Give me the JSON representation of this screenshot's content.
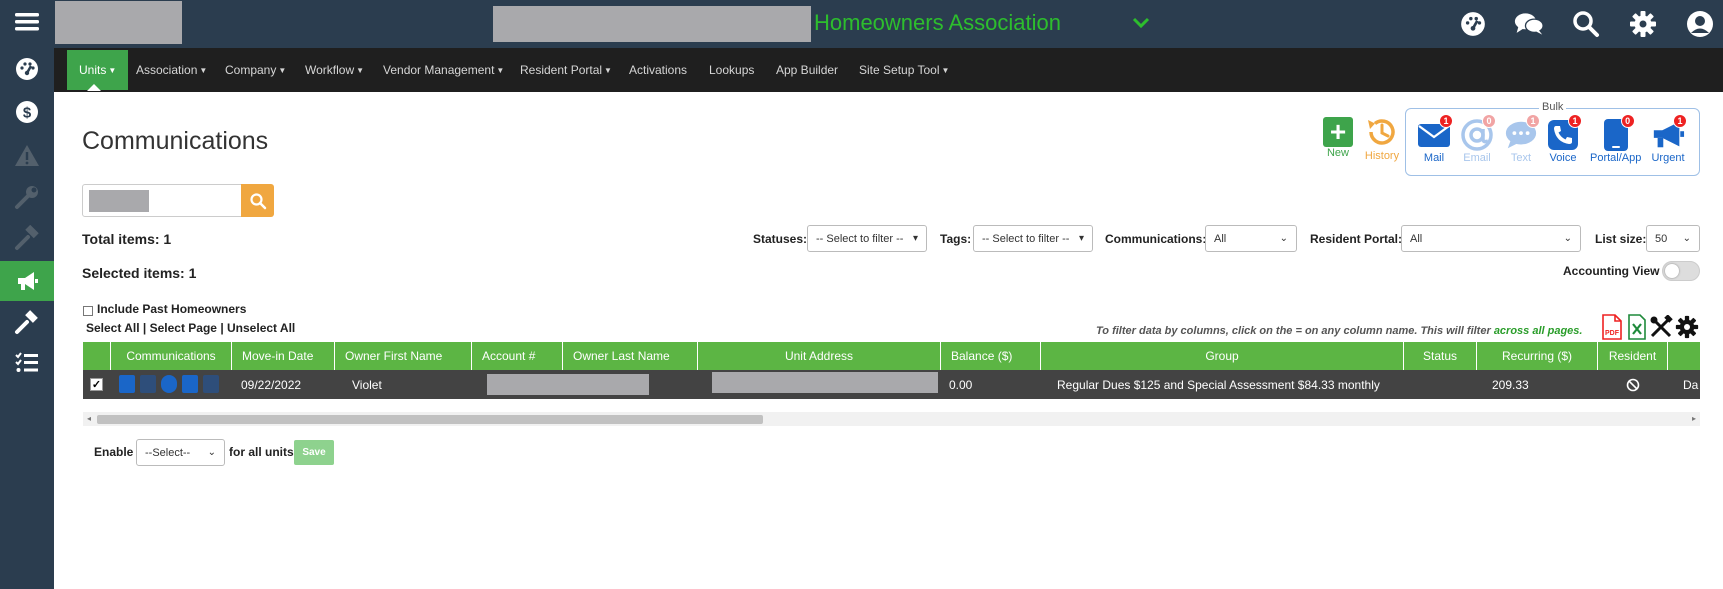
{
  "header": {
    "association_name": "Homeowners Association"
  },
  "menu": {
    "items": [
      {
        "label": "Units",
        "has_caret": true
      },
      {
        "label": "Association",
        "has_caret": true
      },
      {
        "label": "Company",
        "has_caret": true
      },
      {
        "label": "Workflow",
        "has_caret": true
      },
      {
        "label": "Vendor Management",
        "has_caret": true
      },
      {
        "label": "Resident Portal",
        "has_caret": true
      },
      {
        "label": "Activations",
        "has_caret": false
      },
      {
        "label": "Lookups",
        "has_caret": false
      },
      {
        "label": "App Builder",
        "has_caret": false
      },
      {
        "label": "Site Setup Tool",
        "has_caret": true
      }
    ]
  },
  "sidebar": {
    "icons": [
      "menu-icon",
      "dashboard-icon",
      "dollar-icon",
      "warning-icon",
      "wrench-icon",
      "hammer-icon",
      "megaphone-icon",
      "gavel-icon",
      "checklist-icon"
    ],
    "active_index": 6
  },
  "page": {
    "title": "Communications",
    "total_items": "Total items: 1",
    "selected_items": "Selected items: 1",
    "include_past": "Include Past Homeowners",
    "select_all": "Select All",
    "select_page": "Select Page",
    "unselect_all": "Unselect All",
    "link_sep": " | "
  },
  "actions": {
    "new_label": "New",
    "history_label": "History",
    "bulk_label": "Bulk",
    "bulk_items": [
      {
        "label": "Mail",
        "badge": "1",
        "faded": false
      },
      {
        "label": "Email",
        "badge": "0",
        "faded": true
      },
      {
        "label": "Text",
        "badge": "1",
        "faded": true
      },
      {
        "label": "Voice",
        "badge": "1",
        "faded": false
      },
      {
        "label": "Portal/App",
        "badge": "0",
        "faded": false
      },
      {
        "label": "Urgent",
        "badge": "1",
        "faded": false
      }
    ]
  },
  "filters": {
    "statuses_label": "Statuses:",
    "statuses_value": "-- Select to filter --",
    "tags_label": "Tags:",
    "tags_value": "-- Select to filter --",
    "communications_label": "Communications:",
    "communications_value": "All",
    "resident_portal_label": "Resident Portal:",
    "resident_portal_value": "All",
    "list_size_label": "List size:",
    "list_size_value": "50",
    "accounting_view_label": "Accounting View",
    "accounting_view_on": false
  },
  "filter_hint": {
    "text": "To filter data by columns, click on the = on any column name. This will filter ",
    "emphasis": "across all pages."
  },
  "table": {
    "columns": [
      "",
      "Communications",
      "Move-in Date",
      "Owner First Name",
      "Account #",
      "Owner Last Name",
      "Unit Address",
      "Balance ($)",
      "Group",
      "Status",
      "Recurring ($)",
      "Resident",
      ""
    ],
    "rows": [
      {
        "checked": true,
        "move_in_date": "09/22/2022",
        "owner_first_name": "Violet",
        "balance": "0.00",
        "group": "Regular Dues $125 and Special Assessment $84.33 monthly",
        "status": "",
        "recurring": "209.33",
        "trailing": "Da"
      }
    ]
  },
  "footer": {
    "enable_label": "Enable",
    "select_value": "--Select--",
    "for_all_label": "for all units",
    "save_label": "Save"
  },
  "colors": {
    "sidebar_bg": "#2b3d4f",
    "accent_green": "#3ea44b",
    "table_header": "#5cb544",
    "association_title": "#2dbe2d",
    "search_button": "#f0a740",
    "bulk_blue": "#1a66c8",
    "badge_red": "#e22222"
  }
}
